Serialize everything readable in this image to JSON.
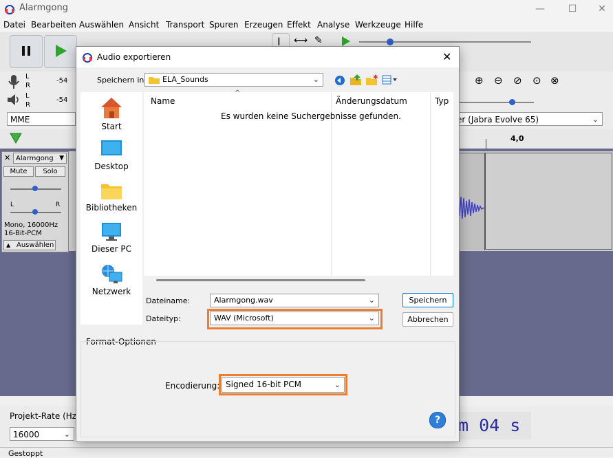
{
  "app": {
    "title": "Alarmgong"
  },
  "menu": [
    "Datei",
    "Bearbeiten",
    "Auswählen",
    "Ansicht",
    "Transport",
    "Spuren",
    "Erzeugen",
    "Effekt",
    "Analyse",
    "Werkzeuge",
    "Hilfe"
  ],
  "meters": {
    "rec_left": "L",
    "rec_right": "R",
    "rec_db": "-54",
    "play_left": "L",
    "play_right": "R",
    "play_db": "-54"
  },
  "devices": {
    "host": "MME",
    "output": "er (Jabra Evolve 65)"
  },
  "timeline": {
    "tick": "4,0"
  },
  "track": {
    "name": "Alarmgong",
    "mute": "Mute",
    "solo": "Solo",
    "pan_left": "L",
    "pan_right": "R",
    "info_line1": "Mono, 16000Hz",
    "info_line2": "16-Bit-PCM",
    "select": "Auswählen"
  },
  "bottom": {
    "rate_label": "Projekt-Rate (Hz)",
    "rate_value": "16000",
    "time_display": "m 04 s"
  },
  "status": {
    "text": "Gestoppt"
  },
  "dialog": {
    "title": "Audio exportieren",
    "look_in_label": "Speichern in:",
    "look_in_value": "ELA_Sounds",
    "places": [
      "Start",
      "Desktop",
      "Bibliotheken",
      "Dieser PC",
      "Netzwerk"
    ],
    "columns": {
      "name": "Name",
      "date": "Änderungsdatum",
      "type": "Typ"
    },
    "empty_message": "Es wurden keine Suchergebnisse gefunden.",
    "filename_label": "Dateiname:",
    "filename_value": "Alarmgong.wav",
    "filetype_label": "Dateityp:",
    "filetype_value": "WAV (Microsoft)",
    "save_button": "Speichern",
    "cancel_button": "Abbrechen",
    "format_group": "Format-Optionen",
    "encoding_label": "Encodierung:",
    "encoding_value": "Signed 16-bit PCM",
    "help": "?"
  },
  "colors": {
    "highlight": "#ed7d31",
    "accent": "#0078d4"
  }
}
